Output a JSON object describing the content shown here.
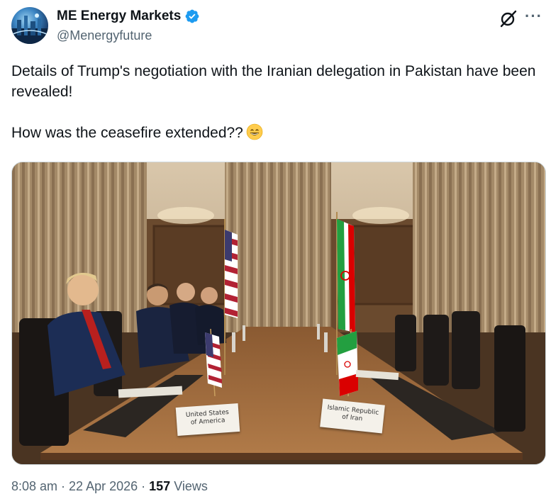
{
  "author": {
    "display_name": "ME Energy Markets",
    "handle": "@Menergyfuture",
    "verified": true,
    "avatar_icon": "avatar-image"
  },
  "actions": {
    "grok_icon": "grok-icon",
    "more_icon": "more-icon"
  },
  "tweet": {
    "line1": "Details of Trump's negotiation with the Iranian delegation in Pakistan have been revealed!",
    "line2": "How was the ceasefire extended??",
    "emoji": "grinning-face-emoji"
  },
  "media": {
    "placard_us_line1": "United States",
    "placard_us_line2": "of America",
    "placard_iran_line1": "Islamic Republic",
    "placard_iran_line2": "of Iran"
  },
  "meta": {
    "time": "8:08 am",
    "separator": " · ",
    "date": "22 Apr 2026",
    "views_count": "157",
    "views_label": " Views"
  },
  "colors": {
    "verified_blue": "#1d9bf0",
    "secondary_text": "#536471",
    "primary_text": "#0f1419"
  }
}
